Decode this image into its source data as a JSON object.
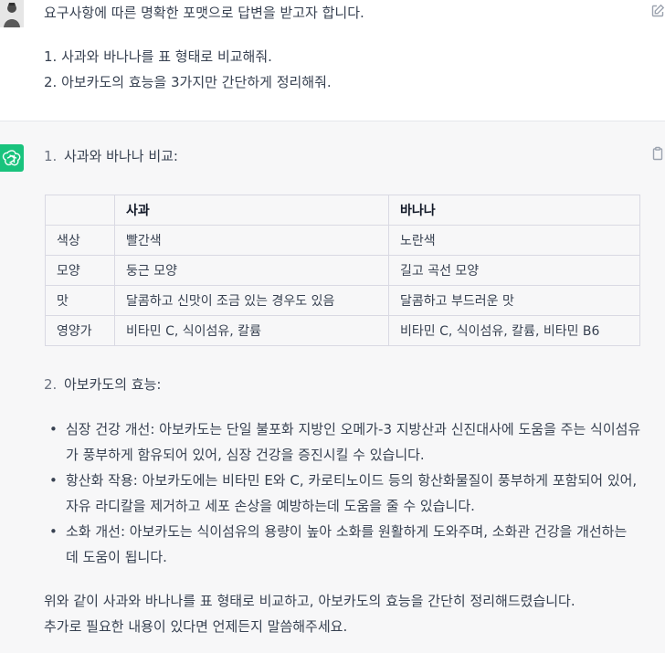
{
  "user_message": {
    "line1": "요구사항에 따른 명확한 포맷으로 답변을 받고자 합니다.",
    "item1": "1. 사과와 바나나를 표 형태로 비교해줘.",
    "item2": "2. 아보카도의 효능을 3가지만 간단하게 정리해줘."
  },
  "assistant": {
    "section1": {
      "num": "1.",
      "title": "사과와 바나나 비교:"
    },
    "table": {
      "headers": [
        "",
        "사과",
        "바나나"
      ],
      "rows": [
        [
          "색상",
          "빨간색",
          "노란색"
        ],
        [
          "모양",
          "둥근 모양",
          "길고 곡선 모양"
        ],
        [
          "맛",
          "달콤하고 신맛이 조금 있는 경우도 있음",
          "달콤하고 부드러운 맛"
        ],
        [
          "영양가",
          "비타민 C, 식이섬유, 칼륨",
          "비타민 C, 식이섬유, 칼륨, 비타민 B6"
        ]
      ]
    },
    "section2": {
      "num": "2.",
      "title": "아보카도의 효능:"
    },
    "benefits": [
      "심장 건강 개선: 아보카도는 단일 불포화 지방인 오메가-3 지방산과 신진대사에 도움을 주는 식이섬유가 풍부하게 함유되어 있어, 심장 건강을 증진시킬 수 있습니다.",
      "항산화 작용: 아보카도에는 비타민 E와 C, 카로티노이드 등의 항산화물질이 풍부하게 포함되어 있어, 자유 라디칼을 제거하고 세포 손상을 예방하는데 도움을 줄 수 있습니다.",
      "소화 개선: 아보카도는 식이섬유의 용량이 높아 소화를 원활하게 도와주며, 소화관 건강을 개선하는 데 도움이 됩니다."
    ],
    "closing_line1": "위와 같이 사과와 바나나를 표 형태로 비교하고, 아보카도의 효능을 간단히 정리해드렸습니다.",
    "closing_line2": "추가로 필요한 내용이 있다면 언제든지 말씀해주세요."
  },
  "icons": {
    "user_avatar": "user-avatar",
    "ai_avatar": "openai-logo-icon",
    "edit": "edit-icon",
    "copy": "clipboard-icon"
  },
  "colors": {
    "ai_avatar_bg": "#19c37d",
    "assistant_bg": "#f7f7f8",
    "text": "#374151"
  }
}
